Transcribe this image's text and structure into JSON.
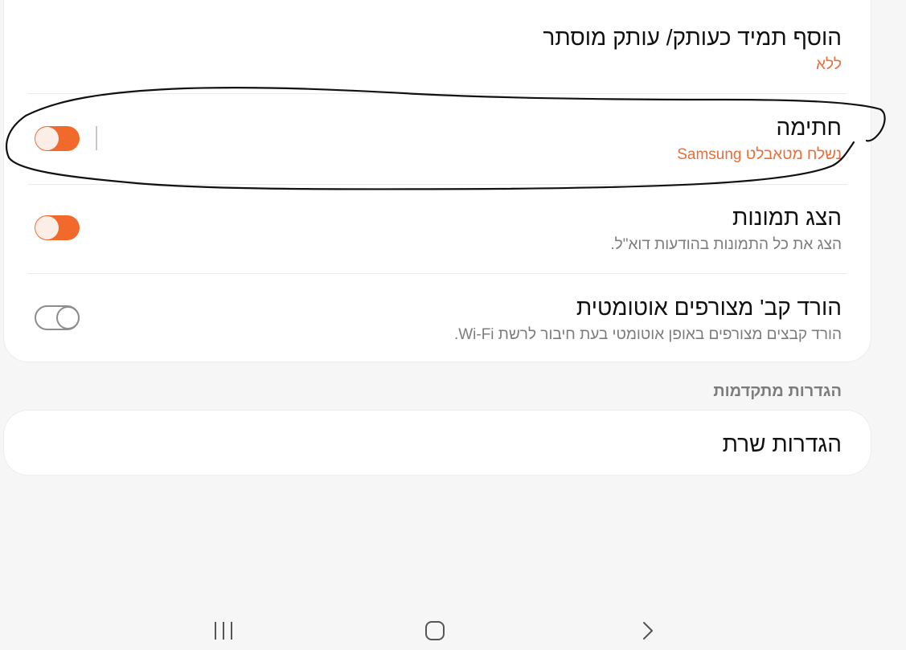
{
  "settings": {
    "hidden_cc": {
      "title": "הוסף תמיד כעותק/ עותק מוסתר",
      "value": "ללא"
    },
    "signature": {
      "title": "חתימה",
      "value": "נשלח מטאבלט Samsung",
      "enabled": true
    },
    "show_images": {
      "title": "הצג תמונות",
      "description": "הצג את כל התמונות בהודעות דוא\"ל.",
      "enabled": true
    },
    "auto_download": {
      "title": "הורד קב' מצורפים אוטומטית",
      "description": "הורד קבצים מצורפים באופן אוטומטי בעת חיבור לרשת Wi-Fi.",
      "enabled": false
    }
  },
  "advanced": {
    "header": "הגדרות מתקדמות",
    "server_settings": "הגדרות שרת"
  },
  "navbar": {
    "icons": [
      "recent-apps-icon",
      "home-icon",
      "back-icon"
    ]
  },
  "colors": {
    "accent": "#f26a2b",
    "subtitle_accent": "#e76f3a",
    "background": "#f6f6f6"
  }
}
